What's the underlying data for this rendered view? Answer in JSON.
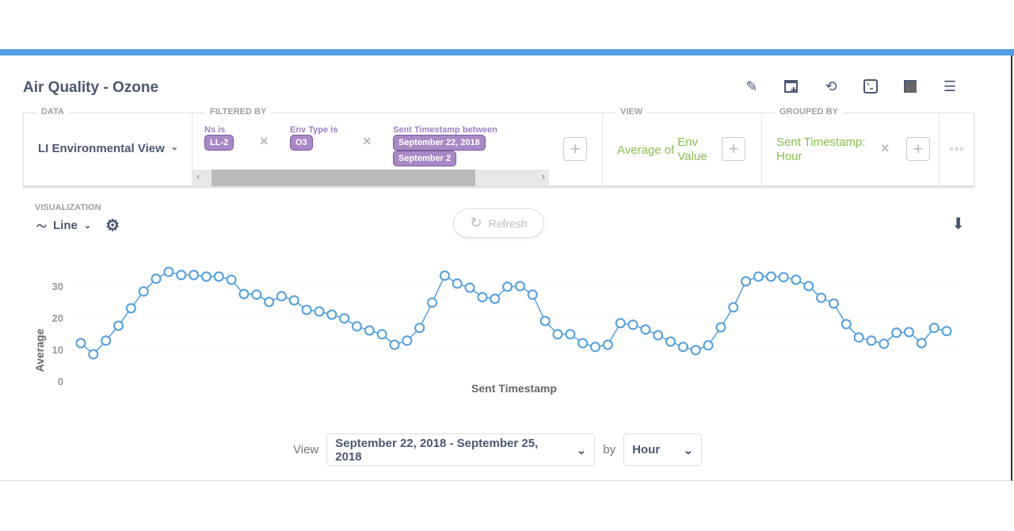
{
  "title": "Air Quality - Ozone",
  "header_icons": [
    "pencil-icon",
    "add-to-dashboard-icon",
    "history-icon",
    "sql-icon",
    "save-icon",
    "menu-icon"
  ],
  "data_section": {
    "label": "DATA",
    "source": "LI Environmental View"
  },
  "filtered_by": {
    "label": "FILTERED BY",
    "filters": [
      {
        "name": "Ns is",
        "values": [
          "LL-2"
        ]
      },
      {
        "name": "Env Type is",
        "values": [
          "O3"
        ]
      },
      {
        "name": "Sent Timestamp between",
        "values": [
          "September 22, 2018",
          "September 2"
        ]
      }
    ]
  },
  "view_section": {
    "label": "VIEW",
    "prefix": "Average of",
    "field": "Env Value"
  },
  "grouped_by": {
    "label": "GROUPED BY",
    "value": "Sent Timestamp: Hour"
  },
  "visualization": {
    "label": "VISUALIZATION",
    "type": "Line"
  },
  "refresh_label": "Refresh",
  "bottom": {
    "view_label": "View",
    "range": "September 22, 2018 - September 25, 2018",
    "by_label": "by",
    "unit": "Hour"
  },
  "colors": {
    "accent": "#509ee3",
    "filter": "#a989c5",
    "view": "#88bf4d"
  },
  "chart_data": {
    "type": "line",
    "xlabel": "Sent Timestamp",
    "ylabel": "Average",
    "ylim": [
      0,
      35
    ],
    "yticks": [
      0,
      10,
      20,
      30
    ],
    "grid": true,
    "values": [
      12,
      8.5,
      12.8,
      17.5,
      23,
      28.3,
      32.3,
      34.5,
      33.5,
      33.5,
      33,
      33,
      32,
      27.5,
      27.3,
      25,
      26.8,
      25.5,
      22.5,
      22,
      21,
      19.8,
      17.3,
      16,
      14.8,
      11.5,
      12.8,
      16.8,
      24.8,
      33.3,
      30.8,
      29.5,
      26.5,
      26,
      29.8,
      30,
      27.3,
      19,
      14.8,
      14.8,
      12,
      10.8,
      11.5,
      18.3,
      17.8,
      16.3,
      14.5,
      12.5,
      10.8,
      9.8,
      11.3,
      17,
      23.3,
      31.5,
      33,
      33,
      32.8,
      32,
      30,
      26.3,
      24.5,
      18,
      13.8,
      12.8,
      11.8,
      15.3,
      15.5,
      12,
      16.8,
      15.8
    ]
  }
}
